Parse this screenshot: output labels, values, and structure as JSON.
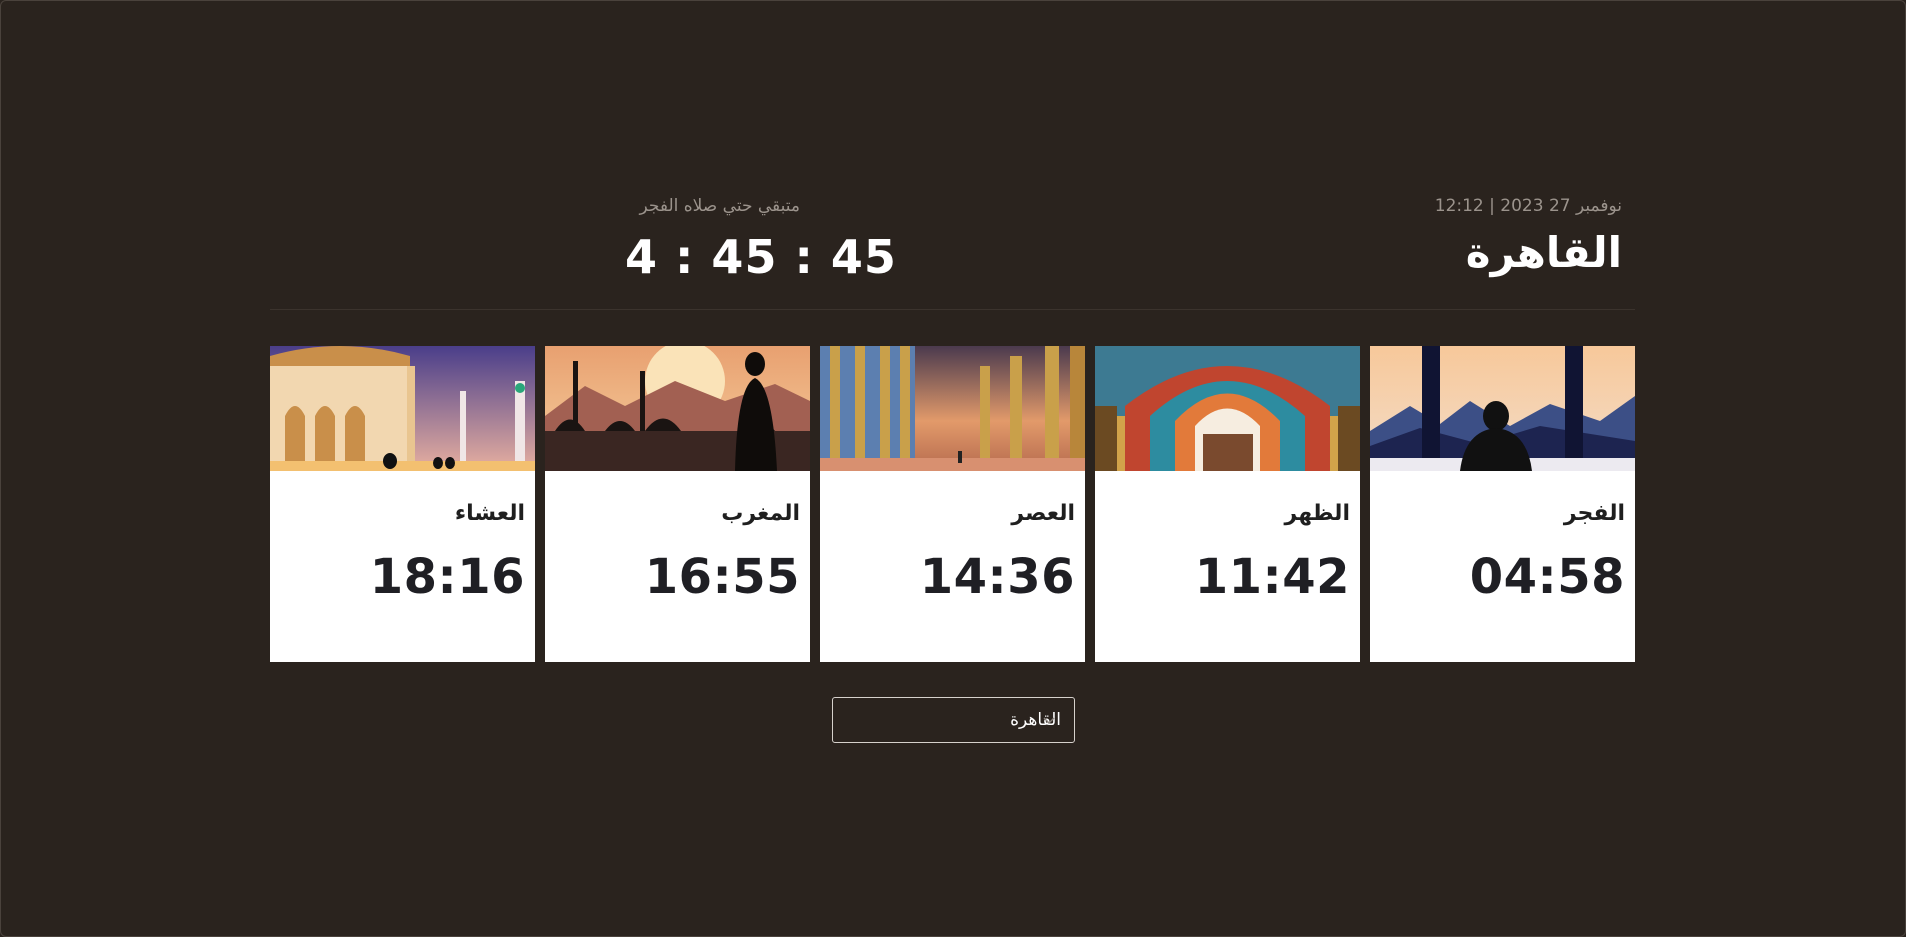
{
  "header": {
    "date_line": "نوفمبر 27 2023 | 12:12",
    "city_title": "القاهرة",
    "countdown_label": "متبقي حتي صلاه الفجر",
    "countdown_value": "4 : 45 : 45"
  },
  "prayers": [
    {
      "name": "الفجر",
      "time": "04:58"
    },
    {
      "name": "الظهر",
      "time": "11:42"
    },
    {
      "name": "العصر",
      "time": "14:36"
    },
    {
      "name": "المغرب",
      "time": "16:55"
    },
    {
      "name": "العشاء",
      "time": "18:16"
    }
  ],
  "city_select": {
    "selected": "القاهرة",
    "icon": "chevron-down-icon"
  },
  "colors": {
    "background": "#2a231e",
    "card": "#ffffff",
    "muted_text": "#9b938c"
  }
}
